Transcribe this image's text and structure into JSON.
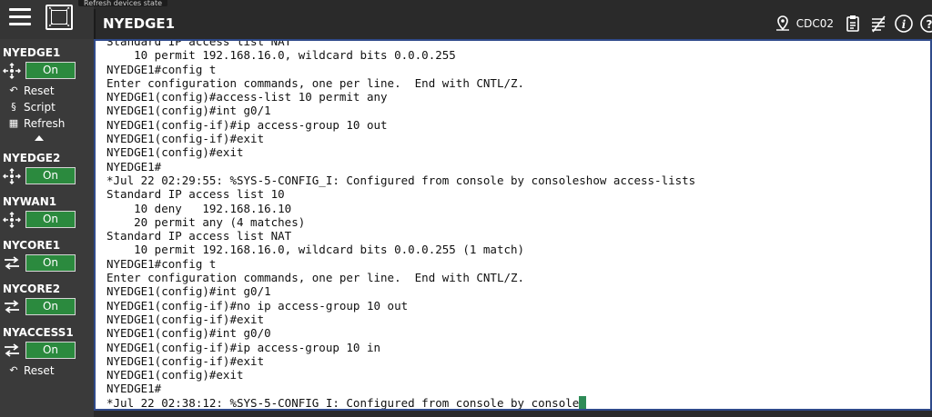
{
  "tooltip": "Refresh devices state",
  "header": {
    "title": "NYEDGE1",
    "site_label": "CDC02"
  },
  "sidebar": {
    "devices": [
      {
        "name": "NYEDGE1",
        "icon": "router-icon",
        "power": "On",
        "expanded": true,
        "actions": [
          {
            "label": "Reset",
            "icon": "reset-icon"
          },
          {
            "label": "Script",
            "icon": "script-icon"
          },
          {
            "label": "Refresh",
            "icon": "refresh-icon"
          }
        ]
      },
      {
        "name": "NYEDGE2",
        "icon": "router-icon",
        "power": "On"
      },
      {
        "name": "NYWAN1",
        "icon": "router-icon",
        "power": "On"
      },
      {
        "name": "NYCORE1",
        "icon": "switch-icon",
        "power": "On"
      },
      {
        "name": "NYCORE2",
        "icon": "switch-icon",
        "power": "On"
      },
      {
        "name": "NYACCESS1",
        "icon": "switch-icon",
        "power": "On",
        "actions": [
          {
            "label": "Reset",
            "icon": "reset-icon"
          }
        ]
      }
    ]
  },
  "terminal": {
    "lines": [
      "Standard IP access list NAT",
      "    10 permit 192.168.16.0, wildcard bits 0.0.0.255",
      "NYEDGE1#config t",
      "Enter configuration commands, one per line.  End with CNTL/Z.",
      "NYEDGE1(config)#access-list 10 permit any",
      "NYEDGE1(config)#int g0/1",
      "NYEDGE1(config-if)#ip access-group 10 out",
      "NYEDGE1(config-if)#exit",
      "NYEDGE1(config)#exit",
      "NYEDGE1#",
      "*Jul 22 02:29:55: %SYS-5-CONFIG_I: Configured from console by consoleshow access-lists",
      "Standard IP access list 10",
      "    10 deny   192.168.16.10",
      "    20 permit any (4 matches)",
      "Standard IP access list NAT",
      "    10 permit 192.168.16.0, wildcard bits 0.0.0.255 (1 match)",
      "NYEDGE1#config t",
      "Enter configuration commands, one per line.  End with CNTL/Z.",
      "NYEDGE1(config)#int g0/1",
      "NYEDGE1(config-if)#no ip access-group 10 out",
      "NYEDGE1(config-if)#exit",
      "NYEDGE1(config)#int g0/0",
      "NYEDGE1(config-if)#ip access-group 10 in",
      "NYEDGE1(config-if)#exit",
      "NYEDGE1(config)#exit",
      "NYEDGE1#",
      "*Jul 22 02:38:12: %SYS-5-CONFIG_I: Configured from console by console"
    ]
  },
  "colors": {
    "on_button": "#2b8a3e",
    "cursor": "#2e8b57",
    "terminal_border": "#2f4a8a"
  }
}
